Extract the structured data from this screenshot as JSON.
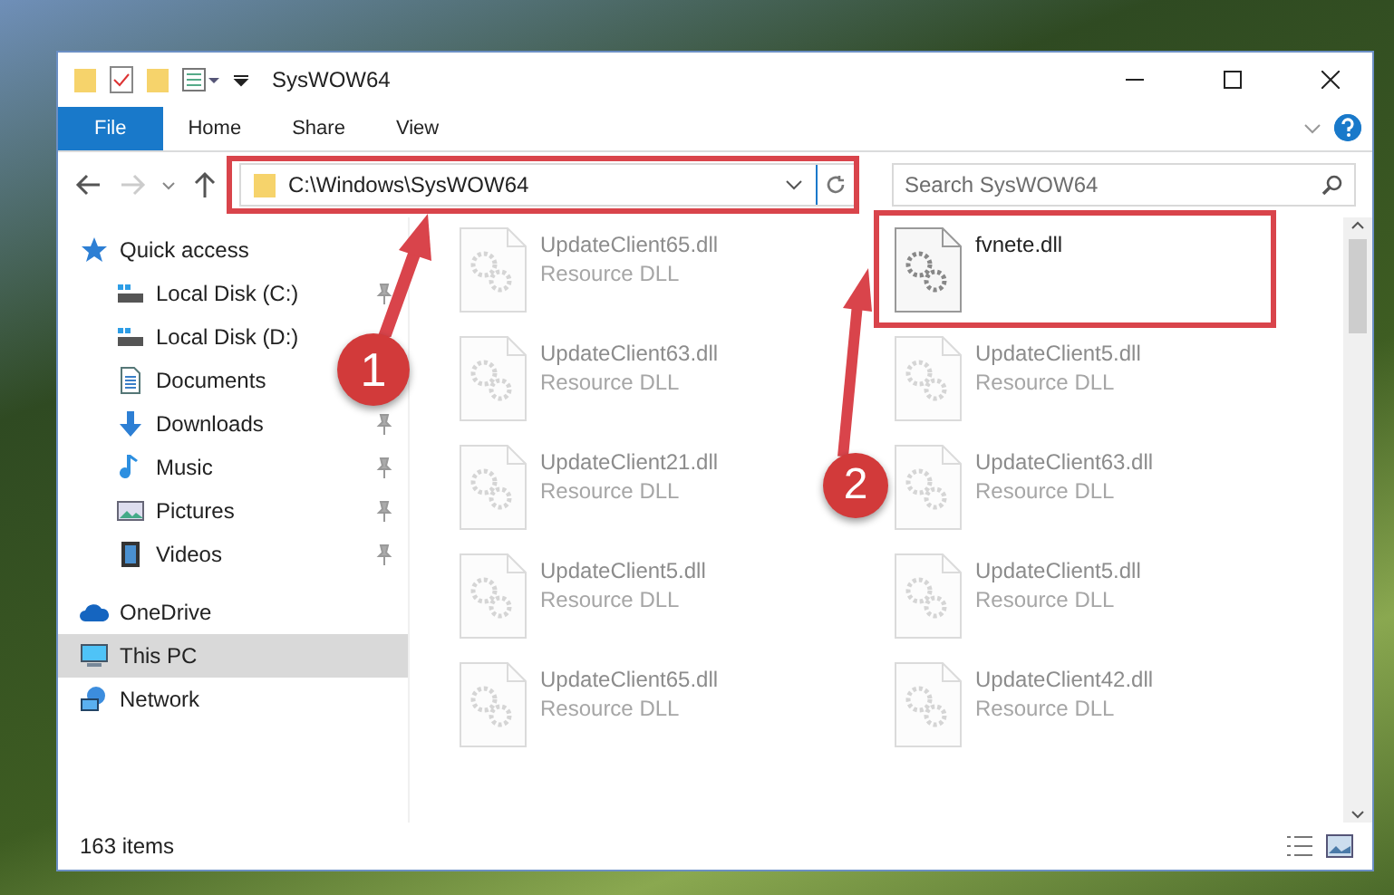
{
  "window": {
    "title": "SysWOW64"
  },
  "ribbon_tabs": [
    {
      "label": "File",
      "selected": true
    },
    {
      "label": "Home",
      "selected": false
    },
    {
      "label": "Share",
      "selected": false
    },
    {
      "label": "View",
      "selected": false
    }
  ],
  "address": {
    "path": "C:\\Windows\\SysWOW64"
  },
  "search": {
    "placeholder": "Search SysWOW64"
  },
  "sidebar": {
    "items": [
      {
        "label": "Quick access",
        "kind": "star",
        "selected": false,
        "children": [
          {
            "label": "Local Disk (C:)",
            "kind": "drive",
            "pinned": true,
            "selected": false
          },
          {
            "label": "Local Disk (D:)",
            "kind": "drive",
            "pinned": false,
            "selected": false
          },
          {
            "label": "Documents",
            "kind": "document",
            "pinned": false,
            "selected": false
          },
          {
            "label": "Downloads",
            "kind": "download",
            "pinned": true,
            "selected": false
          },
          {
            "label": "Music",
            "kind": "music",
            "pinned": true,
            "selected": false
          },
          {
            "label": "Pictures",
            "kind": "picture",
            "pinned": true,
            "selected": false
          },
          {
            "label": "Videos",
            "kind": "video",
            "pinned": true,
            "selected": false
          }
        ]
      },
      {
        "label": "OneDrive",
        "kind": "cloud",
        "selected": false
      },
      {
        "label": "This PC",
        "kind": "computer",
        "selected": true
      },
      {
        "label": "Network",
        "kind": "network",
        "selected": false
      }
    ]
  },
  "files": [
    {
      "name": "UpdateClient65.dll",
      "type": "Resource DLL",
      "dimmed": true
    },
    {
      "name": "fvnete.dll",
      "dimmed": false
    },
    {
      "name": "UpdateClient63.dll",
      "type": "Resource DLL",
      "dimmed": true
    },
    {
      "name": "UpdateClient5.dll",
      "type": "Resource DLL",
      "dimmed": true
    },
    {
      "name": "UpdateClient21.dll",
      "type": "Resource DLL",
      "dimmed": true
    },
    {
      "name": "UpdateClient63.dll",
      "type": "Resource DLL",
      "dimmed": true
    },
    {
      "name": "UpdateClient5.dll",
      "type": "Resource DLL",
      "dimmed": true
    },
    {
      "name": "UpdateClient5.dll",
      "type": "Resource DLL",
      "dimmed": true
    },
    {
      "name": "UpdateClient65.dll",
      "type": "Resource DLL",
      "dimmed": true
    },
    {
      "name": "UpdateClient42.dll",
      "type": "Resource DLL",
      "dimmed": true
    }
  ],
  "status_bar": {
    "item_count": "163 items"
  },
  "annotations": [
    {
      "label": "1"
    },
    {
      "label": "2"
    }
  ]
}
